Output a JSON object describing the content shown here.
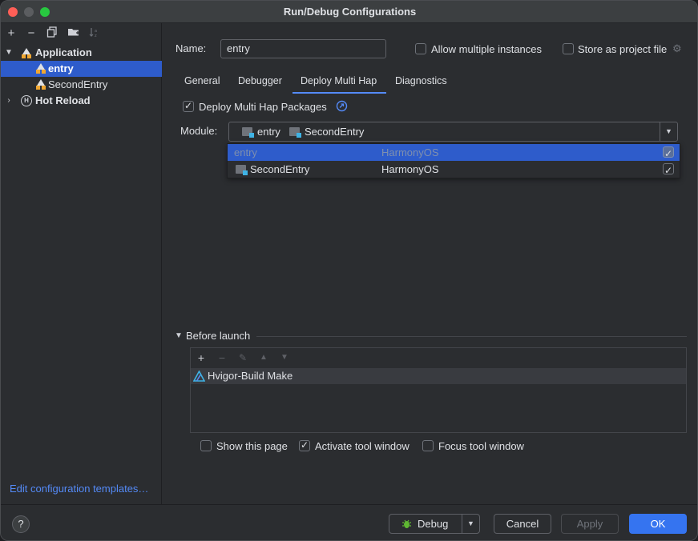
{
  "window": {
    "title": "Run/Debug Configurations"
  },
  "sidebar": {
    "toolbar": [
      "add-icon",
      "remove-icon",
      "copy-icon",
      "folder-icon",
      "sort-icon"
    ],
    "tree": [
      {
        "label": "Application",
        "kind": "group"
      },
      {
        "label": "entry",
        "kind": "config",
        "selected": true
      },
      {
        "label": "SecondEntry",
        "kind": "config"
      },
      {
        "label": "Hot Reload",
        "kind": "group"
      }
    ],
    "edit_templates": "Edit configuration templates…"
  },
  "form": {
    "name_label": "Name:",
    "name_value": "entry",
    "allow_multiple": "Allow multiple instances",
    "store_as_project": "Store as project file"
  },
  "tabs": [
    "General",
    "Debugger",
    "Deploy Multi Hap",
    "Diagnostics"
  ],
  "deploy": {
    "checkbox_label": "Deploy Multi Hap Packages",
    "module_label": "Module:",
    "module_selected": [
      "entry",
      "SecondEntry"
    ],
    "options": [
      {
        "name": "entry",
        "os": "HarmonyOS",
        "checked": true,
        "highlighted": true
      },
      {
        "name": "SecondEntry",
        "os": "HarmonyOS",
        "checked": true
      }
    ]
  },
  "before_launch": {
    "header": "Before launch",
    "items": [
      "Hvigor-Build Make"
    ],
    "show_page": "Show this page",
    "activate_tool_window": "Activate tool window",
    "focus_tool_window": "Focus tool window"
  },
  "footer": {
    "help": "?",
    "debug": "Debug",
    "cancel": "Cancel",
    "apply": "Apply",
    "ok": "OK"
  },
  "colors": {
    "accent": "#3574f0",
    "selection": "#2e5ccb",
    "link": "#548af7"
  }
}
